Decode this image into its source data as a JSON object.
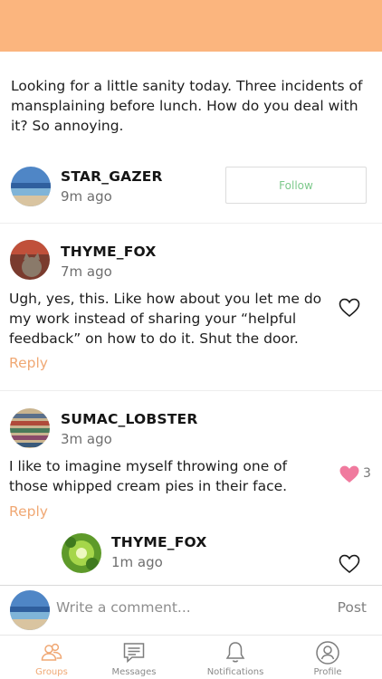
{
  "post": {
    "text": "Looking for a little sanity today. Three incidents of mansplaining before lunch. How do you deal with it? So annoying.",
    "author": "STAR_GAZER",
    "time": "9m ago",
    "follow_label": "Follow"
  },
  "comments": [
    {
      "author": "THYME_FOX",
      "time": "7m ago",
      "text": "Ugh, yes, this. Like how about you let me do my work instead of sharing your “helpful feedback” on how to do it. Shut the door.",
      "reply_label": "Reply",
      "liked": false
    },
    {
      "author": "SUMAC_LOBSTER",
      "time": "3m ago",
      "text": "I like to imagine myself throwing one of those whipped cream pies in their face.",
      "reply_label": "Reply",
      "liked": true,
      "like_count": "3"
    }
  ],
  "reply": {
    "author": "THYME_FOX",
    "time": "1m ago",
    "liked": false
  },
  "composer": {
    "placeholder": "Write a comment...",
    "post_label": "Post"
  },
  "tabs": [
    {
      "label": "Groups",
      "icon": "groups-icon",
      "active": true
    },
    {
      "label": "Messages",
      "icon": "messages-icon",
      "active": false
    },
    {
      "label": "Notifications",
      "icon": "bell-icon",
      "active": false
    },
    {
      "label": "Profile",
      "icon": "profile-icon",
      "active": false
    }
  ],
  "colors": {
    "header": "#FBB57E",
    "accent": "#F0A874",
    "like": "#F07A9E",
    "follow_text": "#7CC98B"
  }
}
